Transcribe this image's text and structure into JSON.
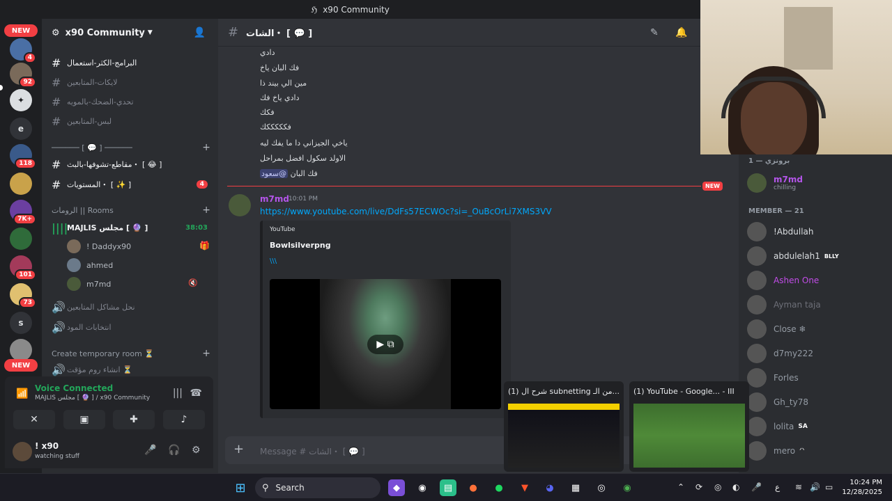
{
  "window": {
    "title": "x90 Community"
  },
  "servers": {
    "items": [
      {
        "label": "NEW",
        "kind": "pill"
      },
      {
        "badge": "4"
      },
      {
        "badge": "92"
      },
      {
        "label": "",
        "kind": "discord"
      },
      {
        "label": "e"
      },
      {
        "badge": "118"
      },
      {
        "badge": ""
      },
      {
        "badge": "7K+"
      },
      {
        "badge": ""
      },
      {
        "badge": "101"
      },
      {
        "badge": "73"
      },
      {
        "label": "s"
      },
      {
        "label": "NEW",
        "kind": "pill"
      }
    ]
  },
  "guild": {
    "name": "x90 Community"
  },
  "channels": {
    "text": [
      {
        "name": "البرامج-الكثر-استعمال",
        "unread": true
      },
      {
        "name": "لايكات-المتابعين",
        "unread": false
      },
      {
        "name": "تحدي-الضحك-بالمويه",
        "unread": false
      },
      {
        "name": "لبس-المتابعين",
        "unread": false
      }
    ],
    "category1": "────── [ 💬 ] ──────",
    "text2": [
      {
        "name": "مقاطع-تشوفها-بالبث・ [ 😂 ]",
        "unread": true,
        "badge": ""
      },
      {
        "name": "المستويات・ [ ✨ ]",
        "unread": true,
        "badge": "4"
      }
    ],
    "rooms_category": "الرومات || Rooms",
    "voice_channel": "MAJLIS مجلس [ 🔮 ]",
    "voice_timer": "38:03",
    "voice_users": [
      "! Daddyx90",
      "ahmed",
      "m7md"
    ],
    "other_voice": [
      "نحل مشاكل المتابعين",
      "انتخابات المود"
    ],
    "temp_category": "Create temporary room ⏳",
    "temp_room": "انشاء روم مؤقت ⏳"
  },
  "voice_panel": {
    "status": "Voice Connected",
    "sub": "MAJLIS مجلس [ 🔮 ] / x90 Community"
  },
  "user_panel": {
    "name": "! x90",
    "status": "watching stuff"
  },
  "chat": {
    "channel": "الشات・ [ 💬 ]",
    "lines": [
      "دادي",
      "فك البان ياخ",
      "مين الي بيند ذا",
      "دادي ياخ فك",
      "فكك",
      "فكككككك",
      "ياخي الجيزاني دا ما يفك ليه",
      "الاولد سكول افضل بمراحل"
    ],
    "mention_line_text": "فك البان",
    "mention": "@سعود",
    "new_label": "NEW",
    "author": "m7md",
    "time": "10:01 PM",
    "link": "https://www.youtube.com/live/DdFs57ECWOc?si=_OuBcOrLi7XMS3VV",
    "embed": {
      "provider": "YouTube",
      "title": "Bowlsilverpng",
      "desc": "\\\\\\"
    },
    "input_placeholder": "Message # الشات・ [ 💬 ]"
  },
  "members": {
    "group1": "برونزي — 1",
    "featured": {
      "name": "m7md",
      "status": "chilling"
    },
    "group2": "MEMBER — 21",
    "list": [
      {
        "name": "!Abdullah",
        "color": "#dbdee1",
        "tag": ""
      },
      {
        "name": "abdulelah1",
        "color": "#dbdee1",
        "tag": "BLLY"
      },
      {
        "name": "Ashen One",
        "color": "#c24ce8",
        "tag": ""
      },
      {
        "name": "Ayman taja",
        "color": "#6d6f78",
        "tag": ""
      },
      {
        "name": "Close ❄",
        "color": "#b5bac1",
        "tag": ""
      },
      {
        "name": "d7my222",
        "color": "#b5bac1",
        "tag": ""
      },
      {
        "name": "Forles",
        "color": "#b5bac1",
        "tag": ""
      },
      {
        "name": "Gh_ty78",
        "color": "#b5bac1",
        "tag": ""
      },
      {
        "name": "lolita",
        "color": "#b5bac1",
        "tag": "SA"
      },
      {
        "name": "mero",
        "color": "#b5bac1",
        "tag": "ᐟᐠ"
      }
    ]
  },
  "previews": [
    {
      "title": "(1) شرح ال subnetting من الـ..."
    },
    {
      "title": "(1) YouTube - Google... - III"
    }
  ],
  "taskbar": {
    "search": "Search",
    "lang": "ع",
    "time": "10:24 PM",
    "date": "12/28/2025"
  },
  "colors": {
    "accent": "#5865f2",
    "danger": "#f23f43",
    "online": "#23a55a",
    "link": "#00a8fc"
  }
}
